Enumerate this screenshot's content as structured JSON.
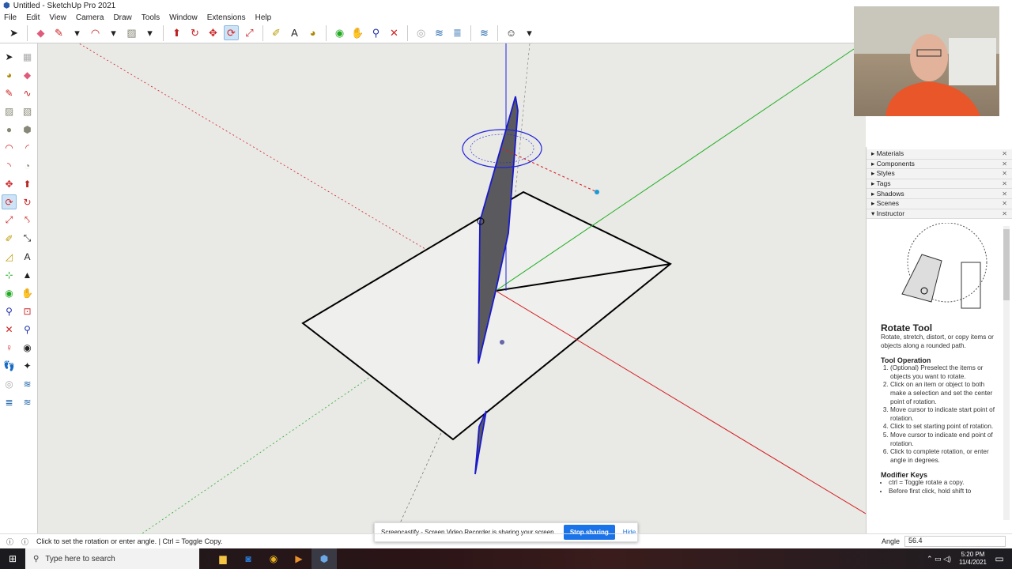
{
  "window": {
    "title": "Untitled - SketchUp Pro 2021"
  },
  "menu": [
    "File",
    "Edit",
    "View",
    "Camera",
    "Draw",
    "Tools",
    "Window",
    "Extensions",
    "Help"
  ],
  "tray": {
    "panels": [
      "Materials",
      "Components",
      "Styles",
      "Tags",
      "Shadows",
      "Scenes",
      "Instructor"
    ]
  },
  "instructor": {
    "title": "Rotate Tool",
    "description": "Rotate, stretch, distort, or copy items or objects along a rounded path.",
    "operation_heading": "Tool Operation",
    "steps": [
      "(Optional) Preselect the items or objects you want to rotate.",
      "Click on an item or object to both make a selection and set the center point of rotation.",
      "Move cursor to indicate start point of rotation.",
      "Click to set starting point of rotation.",
      "Move cursor to indicate end point of rotation.",
      "Click to complete rotation, or enter angle in degrees."
    ],
    "modifier_heading": "Modifier Keys",
    "modifiers": [
      "ctrl = Toggle rotate a copy.",
      "Before first click, hold shift to"
    ]
  },
  "status": {
    "message": "Click to set the rotation or enter angle. | Ctrl = Toggle Copy.",
    "measure_label": "Angle",
    "measure_value": "56.4"
  },
  "share": {
    "message": "Screencastify - Screen Video Recorder is sharing your screen.",
    "stop": "Stop sharing",
    "hide": "Hide"
  },
  "taskbar": {
    "search_placeholder": "Type here to search",
    "time": "5:20 PM",
    "date": "11/4/2021"
  },
  "colors": {
    "accent": "#1a73e8",
    "selected": "#1a1acc",
    "red_axis": "#d42020",
    "green_axis": "#22b022"
  }
}
